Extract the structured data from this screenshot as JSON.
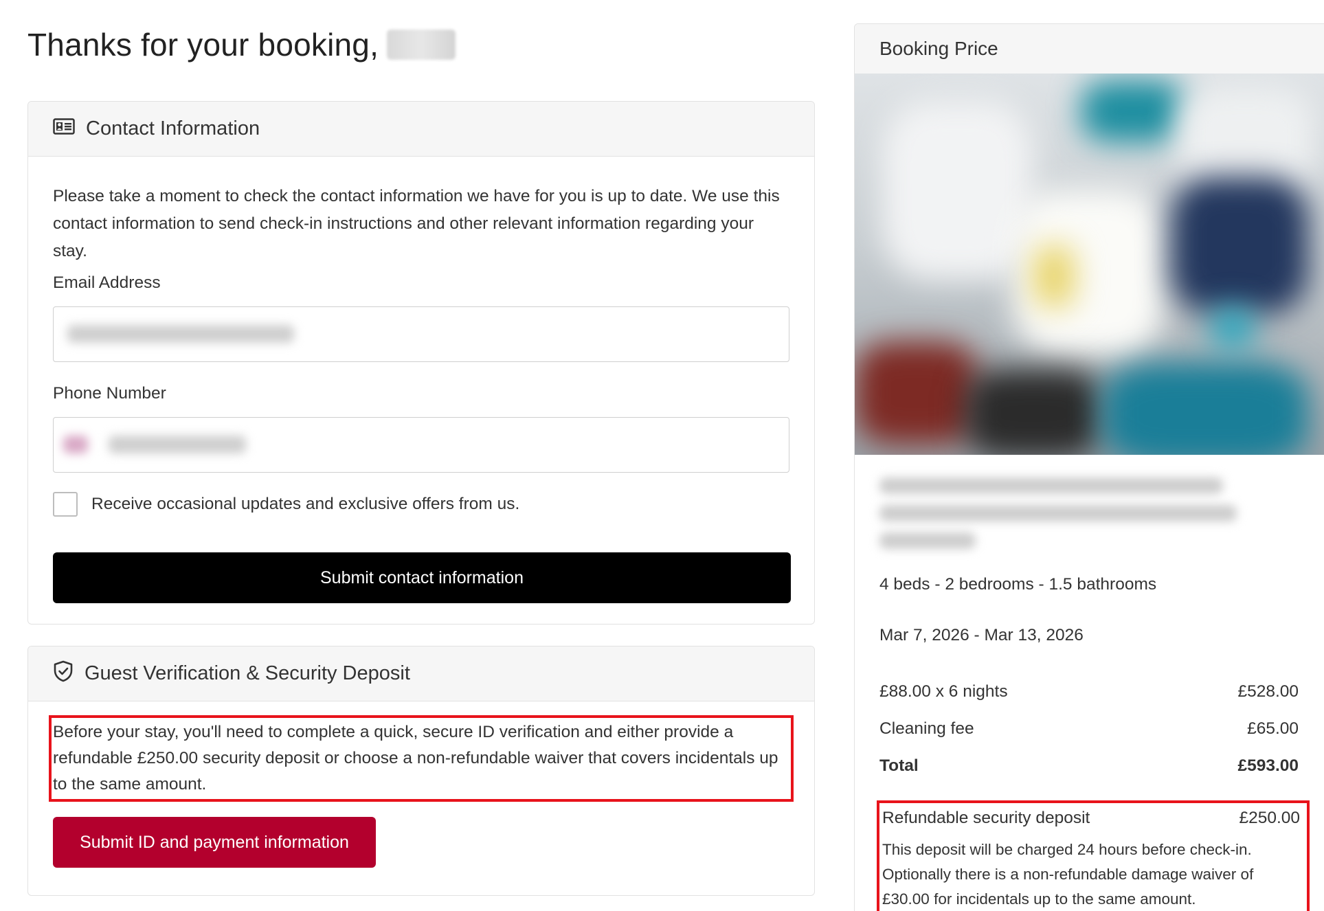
{
  "header": {
    "title": "Thanks for your booking,"
  },
  "contact": {
    "title": "Contact Information",
    "intro": "Please take a moment to check the contact information we have for you is up to date. We use this contact information to send check-in instructions and other relevant information regarding your stay.",
    "email_label": "Email Address",
    "phone_label": "Phone Number",
    "updates_label": "Receive occasional updates and exclusive offers from us.",
    "submit_label": "Submit contact information"
  },
  "verification": {
    "title": "Guest Verification & Security Deposit",
    "text": "Before your stay, you'll need to complete a quick, secure ID verification and either provide a refundable £250.00 security deposit or choose a non-refundable waiver that covers incidentals up to the same amount.",
    "submit_label": "Submit ID and payment information"
  },
  "price": {
    "title": "Booking Price",
    "features": "4 beds - 2 bedrooms - 1.5 bathrooms",
    "dates": "Mar 7, 2026 - Mar 13, 2026",
    "lines": [
      {
        "label": "£88.00 x 6 nights",
        "amount": "£528.00"
      },
      {
        "label": "Cleaning fee",
        "amount": "£65.00"
      }
    ],
    "total": {
      "label": "Total",
      "amount": "£593.00"
    },
    "deposit": {
      "label": "Refundable security deposit",
      "amount": "£250.00",
      "note": "This deposit will be charged 24 hours before check-in. Optionally there is a non-refundable damage waiver of £30.00 for incidentals up to the same amount."
    }
  },
  "colors": {
    "primary_button": "#000000",
    "verify_button": "#b3002d",
    "highlight": "#e8131b"
  },
  "icons": {
    "contact": "id-card-icon",
    "verification": "shield-check-icon"
  }
}
